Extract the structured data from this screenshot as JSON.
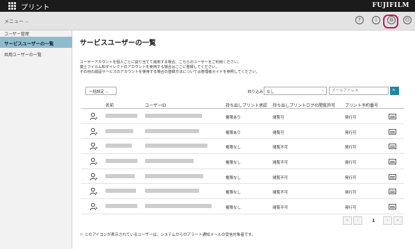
{
  "app": {
    "title": "プリント",
    "brand": "FUJIFILM"
  },
  "menubar": {
    "menu_label": "メニュー",
    "icons": [
      "help-icon",
      "info-icon",
      "gear-icon",
      "power-icon"
    ],
    "help_glyph": "?",
    "info_glyph": "i",
    "gear_glyph": "⚙",
    "power_glyph": "⏻",
    "highlight_color": "#c0175d"
  },
  "sidebar": {
    "section": "ユーザー管理",
    "active_item": "サービスユーザーの一覧",
    "item": "共用ユーザーの一覧",
    "active_color": "#8fbccd"
  },
  "main": {
    "title": "サービスユーザーの一覧",
    "desc_line1": "ユーザーアカウントを個人ごとに割り当てて運用する場合、こちらのユーザーをご利用ください。",
    "desc_line2": "富士フイルムBIダイレクトのアカウントを使用する場合はここに登録してください。",
    "desc_line3": "その他の認証サービスのアカウントを使用する場合の登録方法については管理者ガイドを参照してください。",
    "bulk_button": "一括設定",
    "filter_label": "絞り込み",
    "filter_value": "なし",
    "search_placeholder": "メールアドレス",
    "search_glyph": "🔍",
    "accent_color": "#1a8aa2"
  },
  "table": {
    "headers": {
      "name": "名前",
      "user_id": "ユーザーID",
      "approval": "持ち出しプリント承認",
      "log": "持ち出しプリントログの閲覧許可",
      "reservation": "プリント予約番号"
    },
    "rows": [
      {
        "approval": "権限あり",
        "log": "閲覧可",
        "reservation": "発行可"
      },
      {
        "approval": "権限あり",
        "log": "閲覧可",
        "reservation": "発行可"
      },
      {
        "approval": "権限なし",
        "log": "閲覧不可",
        "reservation": "発行可"
      },
      {
        "approval": "権限なし",
        "log": "閲覧不可",
        "reservation": "発行可"
      },
      {
        "approval": "権限なし",
        "log": "閲覧不可",
        "reservation": "発行可"
      },
      {
        "approval": "権限なし",
        "log": "閲覧不可",
        "reservation": "発行可"
      },
      {
        "approval": "権限なし",
        "log": "閲覧不可",
        "reservation": "発行可"
      }
    ]
  },
  "pager": {
    "current_page": "1",
    "first": "«",
    "prev": "‹",
    "next": "›",
    "last": "»"
  },
  "footnote": "このアイコンが表示されているユーザーは、システムからのアラート通知メールの受信対象者です。"
}
